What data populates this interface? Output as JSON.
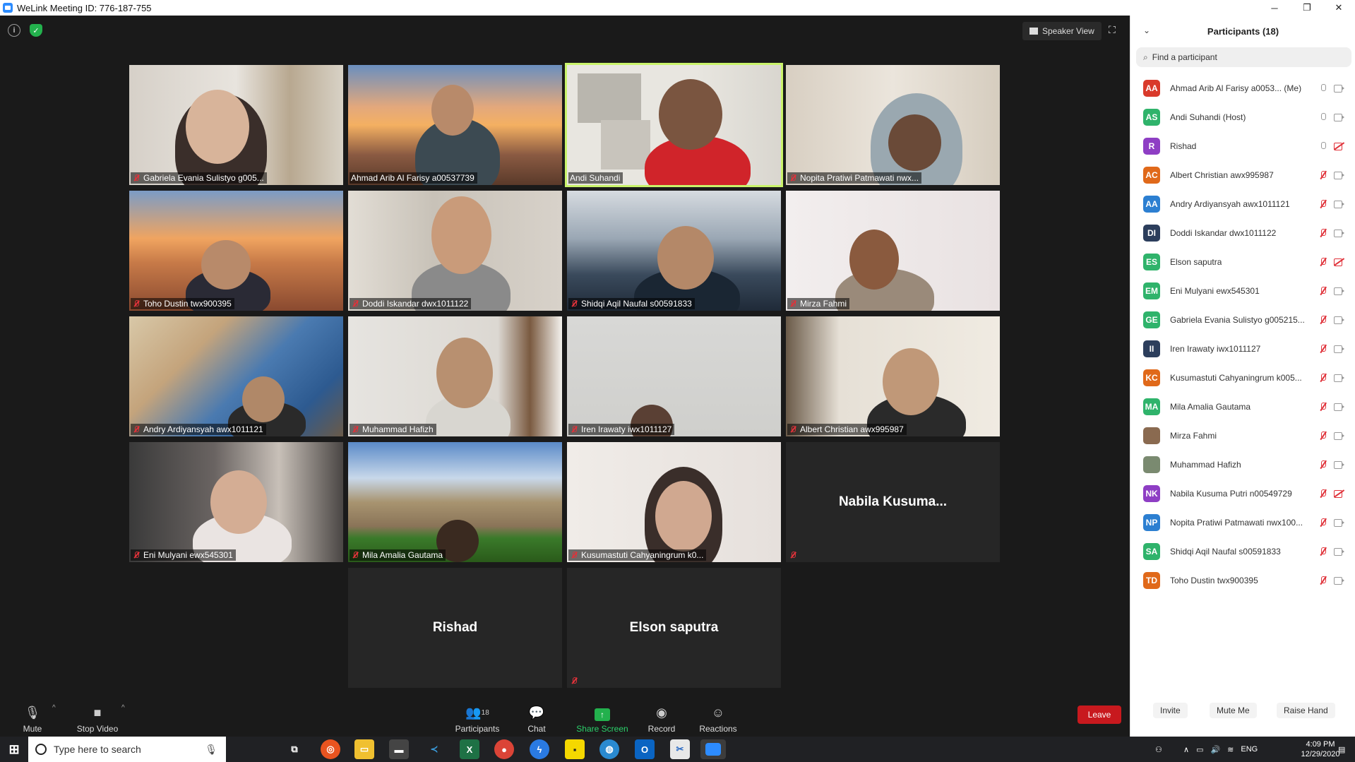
{
  "window": {
    "title": "WeLink Meeting ID: 776-187-755",
    "minimize": "─",
    "restore": "❐",
    "close": "✕"
  },
  "top": {
    "view_label": "Speaker View"
  },
  "tiles": [
    {
      "name": "Gabriela Evania Sulistyo g005..."
    },
    {
      "name": "Ahmad Arib Al Farisy a00537739"
    },
    {
      "name": "Andi Suhandi"
    },
    {
      "name": "Nopita Pratiwi Patmawati nwx..."
    },
    {
      "name": "Toho Dustin twx900395"
    },
    {
      "name": "Doddi Iskandar dwx1011122"
    },
    {
      "name": "Shidqi Aqil Naufal s00591833"
    },
    {
      "name": "Mirza Fahmi"
    },
    {
      "name": "Andry Ardiyansyah awx1011121"
    },
    {
      "name": "Muhammad Hafizh"
    },
    {
      "name": "Iren Irawaty iwx1011127"
    },
    {
      "name": "Albert Christian awx995987"
    },
    {
      "name": "Eni Mulyani ewx545301"
    },
    {
      "name": "Mila Amalia Gautama"
    },
    {
      "name": "Kusumastuti Cahyaningrum k0..."
    },
    {
      "name": "Nabila  Kusuma..."
    },
    {
      "name": "Rishad"
    },
    {
      "name": "Elson saputra"
    }
  ],
  "toolbar": {
    "mute": "Mute",
    "stop_video": "Stop Video",
    "participants": "Participants",
    "participants_count": "18",
    "chat": "Chat",
    "share": "Share Screen",
    "record": "Record",
    "reactions": "Reactions",
    "leave": "Leave"
  },
  "panel": {
    "title": "Participants (18)",
    "search_placeholder": "Find a participant",
    "participants": [
      {
        "initials": "AA",
        "name": "Ahmad Arib Al Farisy a0053...  (Me)",
        "color": "#d93a2b",
        "mic": "on",
        "cam": "on"
      },
      {
        "initials": "AS",
        "name": "Andi Suhandi (Host)",
        "color": "#2fb36b",
        "mic": "on",
        "cam": "on"
      },
      {
        "initials": "R",
        "name": "Rishad",
        "color": "#8e3ec4",
        "mic": "on",
        "cam": "off"
      },
      {
        "initials": "AC",
        "name": "Albert Christian awx995987",
        "color": "#e0691a",
        "mic": "off",
        "cam": "on"
      },
      {
        "initials": "AA",
        "name": "Andry Ardiyansyah awx1011121",
        "color": "#2c7fd1",
        "mic": "off",
        "cam": "on"
      },
      {
        "initials": "DI",
        "name": "Doddi Iskandar dwx1011122",
        "color": "#2c3e5c",
        "mic": "off",
        "cam": "on"
      },
      {
        "initials": "ES",
        "name": "Elson saputra",
        "color": "#2fb36b",
        "mic": "off",
        "cam": "off"
      },
      {
        "initials": "EM",
        "name": "Eni Mulyani ewx545301",
        "color": "#2fb36b",
        "mic": "off",
        "cam": "on"
      },
      {
        "initials": "GE",
        "name": "Gabriela Evania Sulistyo g005215...",
        "color": "#2fb36b",
        "mic": "off",
        "cam": "on"
      },
      {
        "initials": "II",
        "name": "Iren Irawaty iwx1011127",
        "color": "#2c3e5c",
        "mic": "off",
        "cam": "on"
      },
      {
        "initials": "KC",
        "name": "Kusumastuti Cahyaningrum k005...",
        "color": "#e0691a",
        "mic": "off",
        "cam": "on"
      },
      {
        "initials": "MA",
        "name": "Mila Amalia Gautama",
        "color": "#2fb36b",
        "mic": "off",
        "cam": "on"
      },
      {
        "initials": "",
        "name": "Mirza Fahmi",
        "color": "#8a6a50",
        "mic": "off",
        "cam": "on"
      },
      {
        "initials": "",
        "name": "Muhammad Hafizh",
        "color": "#7a8a70",
        "mic": "off",
        "cam": "on"
      },
      {
        "initials": "NK",
        "name": "Nabila Kusuma Putri n00549729",
        "color": "#8e3ec4",
        "mic": "off",
        "cam": "off"
      },
      {
        "initials": "NP",
        "name": "Nopita Pratiwi Patmawati nwx100...",
        "color": "#2c7fd1",
        "mic": "off",
        "cam": "on"
      },
      {
        "initials": "SA",
        "name": "Shidqi Aqil Naufal s00591833",
        "color": "#2fb36b",
        "mic": "off",
        "cam": "on"
      },
      {
        "initials": "TD",
        "name": "Toho Dustin twx900395",
        "color": "#e0691a",
        "mic": "off",
        "cam": "on"
      }
    ],
    "invite": "Invite",
    "mute_me": "Mute Me",
    "raise_hand": "Raise Hand"
  },
  "taskbar": {
    "search_placeholder": "Type here to search",
    "language": "ENG",
    "time": "4:09 PM",
    "date": "12/29/2020"
  }
}
